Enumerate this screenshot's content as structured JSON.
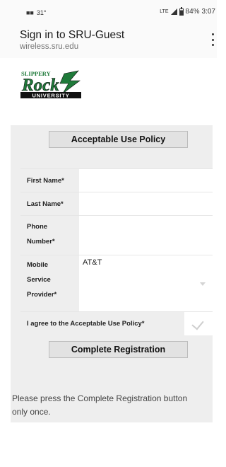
{
  "status_bar": {
    "notification_text": "31°",
    "network": "LTE",
    "battery": "84%",
    "time": "3:07",
    "icons": [
      "notification-icon",
      "signal-icon",
      "battery-icon"
    ]
  },
  "header": {
    "title": "Sign in to SRU-Guest",
    "url": "wireless.sru.edu",
    "menu_icon": "kebab-menu-icon"
  },
  "logo": {
    "line1": "SLIPPERY",
    "line2": "Rock",
    "line3": "UNIVERSITY",
    "colors": {
      "green": "#1f7a3a",
      "black": "#111111"
    }
  },
  "form": {
    "aup_button": "Acceptable Use Policy",
    "fields": {
      "first_name": {
        "label": "First Name*",
        "value": ""
      },
      "last_name": {
        "label": "Last Name*",
        "value": ""
      },
      "phone": {
        "label_line1": "Phone",
        "label_line2": "Number*",
        "value": ""
      },
      "provider": {
        "label_line1": "Mobile",
        "label_line2": "Service",
        "label_line3": "Provider*",
        "value": "AT&T"
      }
    },
    "agree_label": "I agree to the Acceptable Use Policy*",
    "complete_button": "Complete Registration",
    "note": "Please press the Complete Registration button only once."
  },
  "colors": {
    "panel_bg": "#eeeeee",
    "button_bg": "#e2e2e2",
    "field_bg": "#ffffff"
  }
}
